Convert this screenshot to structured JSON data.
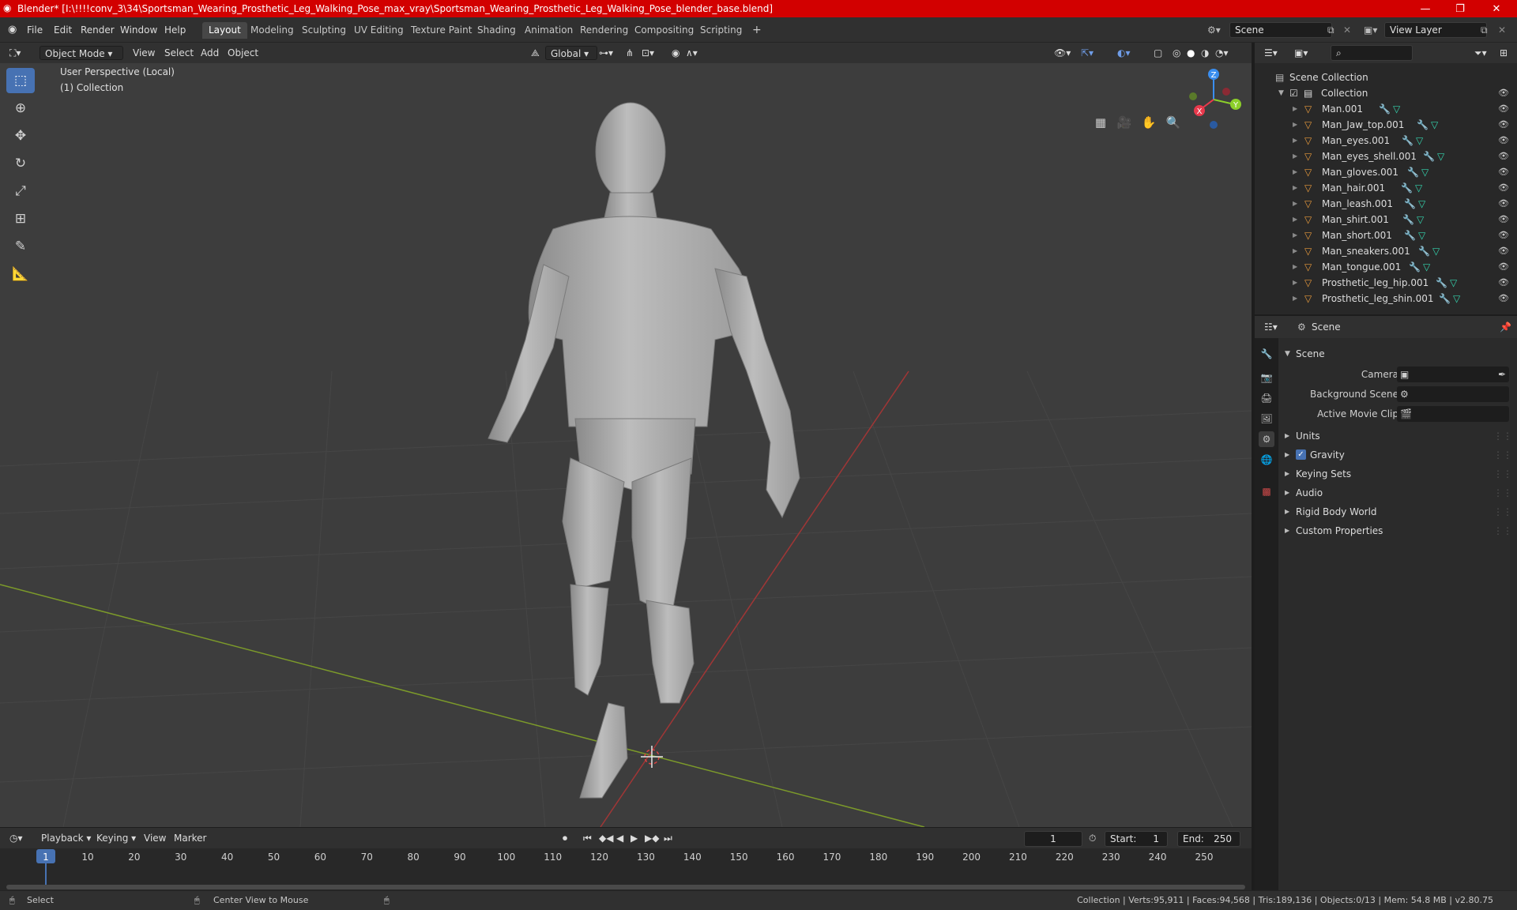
{
  "window": {
    "title": "Blender* [I:\\!!!!conv_3\\34\\Sportsman_Wearing_Prosthetic_Leg_Walking_Pose_max_vray\\Sportsman_Wearing_Prosthetic_Leg_Walking_Pose_blender_base.blend]",
    "minimize": "—",
    "maximize": "❐",
    "close": "✕"
  },
  "menu": [
    "File",
    "Edit",
    "Render",
    "Window",
    "Help"
  ],
  "workspaces": [
    "Layout",
    "Modeling",
    "Sculpting",
    "UV Editing",
    "Texture Paint",
    "Shading",
    "Animation",
    "Rendering",
    "Compositing",
    "Scripting"
  ],
  "add_workspace": "+",
  "scene_field": "Scene",
  "view_layer_field": "View Layer",
  "viewport": {
    "mode": "Object Mode",
    "menus": [
      "View",
      "Select",
      "Add",
      "Object"
    ],
    "transform_orientation": "Global",
    "perspective_label": "User Perspective (Local)",
    "collection_label": "(1) Collection",
    "gizmo": {
      "x": "X",
      "y": "Y",
      "z": "Z"
    }
  },
  "outliner": {
    "root": "Scene Collection",
    "collection": "Collection",
    "items": [
      "Man.001",
      "Man_Jaw_top.001",
      "Man_eyes.001",
      "Man_eyes_shell.001",
      "Man_gloves.001",
      "Man_hair.001",
      "Man_leash.001",
      "Man_shirt.001",
      "Man_short.001",
      "Man_sneakers.001",
      "Man_tongue.001",
      "Prosthetic_leg_hip.001",
      "Prosthetic_leg_shin.001"
    ]
  },
  "properties": {
    "header": "Scene",
    "panel": "Scene",
    "fields": [
      {
        "label": "Camera"
      },
      {
        "label": "Background Scene"
      },
      {
        "label": "Active Movie Clip"
      }
    ],
    "sections": [
      "Units",
      "Gravity",
      "Keying Sets",
      "Audio",
      "Rigid Body World",
      "Custom Properties"
    ]
  },
  "timeline": {
    "menus": [
      "Playback",
      "Keying",
      "View",
      "Marker"
    ],
    "current_frame": "1",
    "start_label": "Start:",
    "start": "1",
    "end_label": "End:",
    "end": "250",
    "ticks": [
      "1",
      "10",
      "20",
      "30",
      "40",
      "50",
      "60",
      "70",
      "80",
      "90",
      "100",
      "110",
      "120",
      "130",
      "140",
      "150",
      "160",
      "170",
      "180",
      "190",
      "200",
      "210",
      "220",
      "230",
      "240",
      "250"
    ]
  },
  "status": {
    "select": "Select",
    "center": "Center View to Mouse",
    "stats": "Collection | Verts:95,911 | Faces:94,568 | Tris:189,136 | Objects:0/13 | Mem: 54.8 MB | v2.80.75"
  },
  "colors": {
    "titlebar": "#d20000",
    "accent": "#4772b3",
    "x_axis": "#e8394c",
    "y_axis": "#8ccf2a",
    "z_axis": "#3a8ef0"
  }
}
